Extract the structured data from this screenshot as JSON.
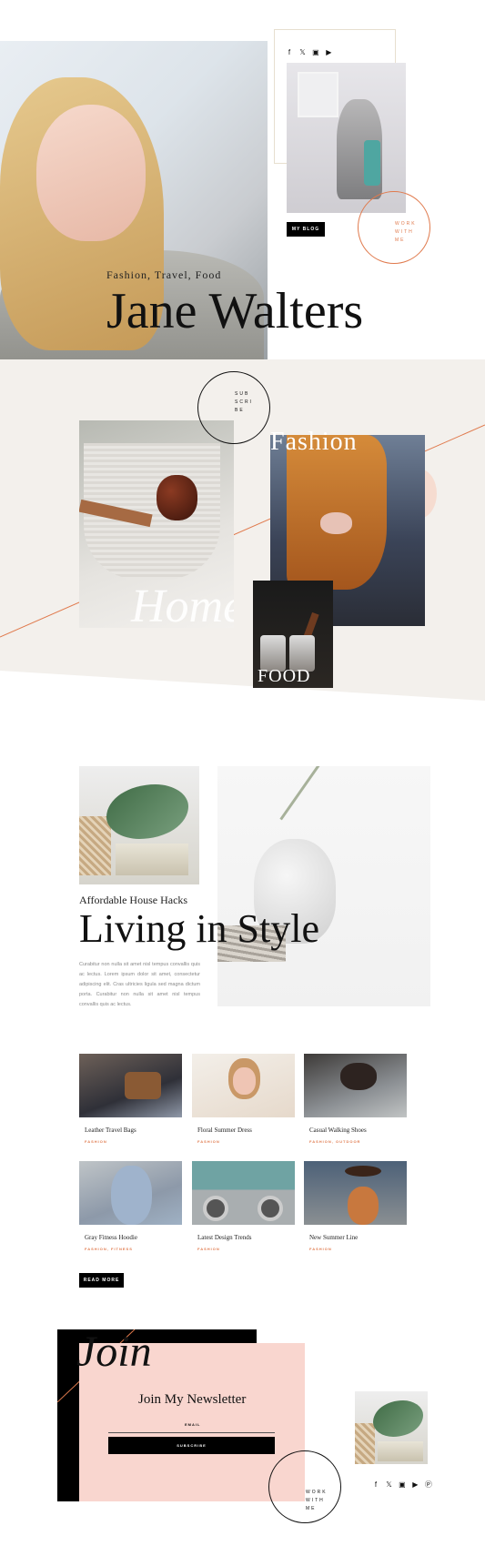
{
  "hero": {
    "subtitle": "Fashion, Travel, Food",
    "title": "Jane Walters",
    "my_blog_label": "MY BLOG",
    "work_with_me": [
      "WORK",
      "WITH",
      "ME"
    ],
    "social_icons": [
      "facebook-icon",
      "twitter-icon",
      "instagram-icon",
      "youtube-icon"
    ]
  },
  "categories": {
    "subscribe": [
      "SUB",
      "SCRI",
      "BE"
    ],
    "items": [
      {
        "label": "Home"
      },
      {
        "label": "Fashion"
      },
      {
        "label": "FOOD"
      }
    ]
  },
  "feature": {
    "kicker": "Affordable House Hacks",
    "title": "Living in Style",
    "body": "Curabitur non nulla sit amet nisl tempus convallis quis ac lectus. Lorem ipsum dolor sit amet, consectetur adipiscing elit. Cras ultricies ligula sed magna dictum porta. Curabitur non nulla sit amet nisl tempus convallis quis ac lectus."
  },
  "posts": [
    {
      "title": "Leather Travel Bags",
      "tags": "FASHION"
    },
    {
      "title": "Floral Summer Dress",
      "tags": "FASHION"
    },
    {
      "title": "Casual Walking Shoes",
      "tags": "FASHION, OUTDOOR"
    },
    {
      "title": "Gray Fitness Hoodie",
      "tags": "FASHION, FITNESS"
    },
    {
      "title": "Latest Design Trends",
      "tags": "FASHION"
    },
    {
      "title": "New Summer Line",
      "tags": "FASHION"
    }
  ],
  "read_more_label": "READ MORE",
  "newsletter": {
    "script_word": "Join",
    "title": "Join My Newsletter",
    "email_label": "EMAIL",
    "subscribe_label": "SUBSCRIBE",
    "work_with_me": [
      "WORK",
      "WITH",
      "ME"
    ],
    "social_icons": [
      "facebook-icon",
      "twitter-icon",
      "instagram-icon",
      "youtube-icon",
      "pinterest-icon"
    ]
  },
  "colors": {
    "accent": "#e07a4d",
    "beige": "#f3f0ec",
    "pink": "#f9d6cf",
    "black": "#000000"
  }
}
